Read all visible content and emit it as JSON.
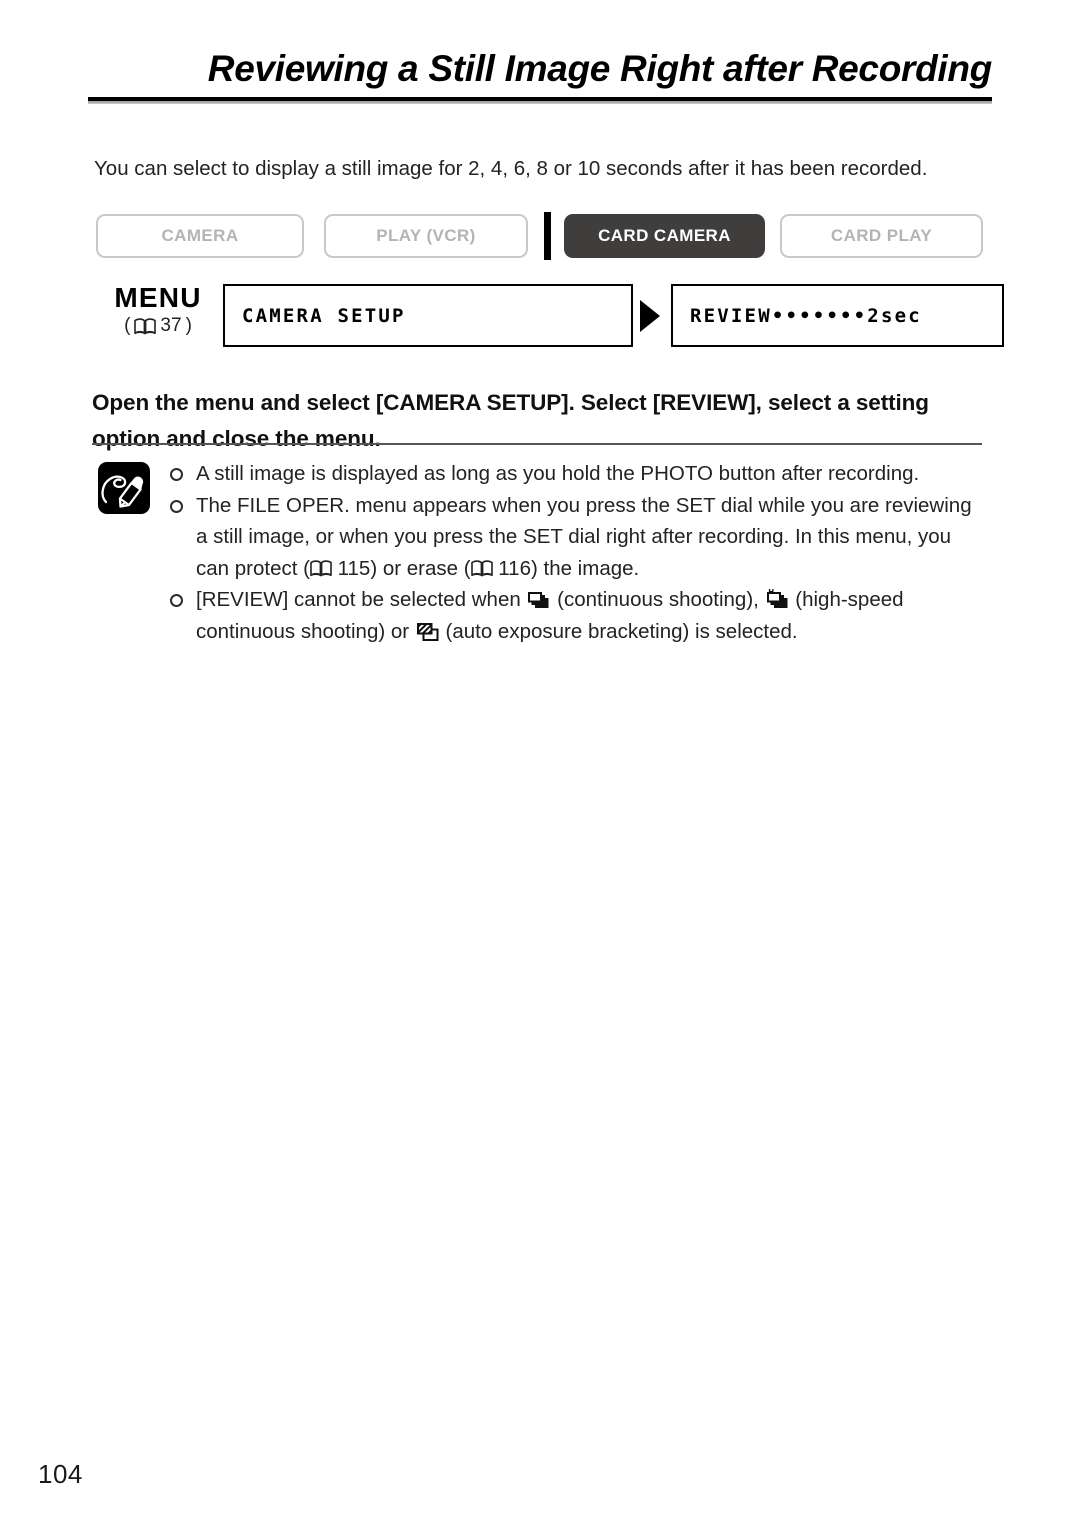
{
  "document": {
    "title": "Reviewing a Still Image Right after Recording",
    "intro": "You can select to display a still image for 2, 4, 6, 8 or 10 seconds after it has been recorded.",
    "page_number": "104"
  },
  "modes": {
    "items": [
      {
        "label": "CAMERA",
        "active": false
      },
      {
        "label": "PLAY (VCR)",
        "active": false
      },
      {
        "label": "CARD CAMERA",
        "active": true
      },
      {
        "label": "CARD PLAY",
        "active": false
      }
    ]
  },
  "menu": {
    "label": "MENU",
    "reference_icon": "book-icon",
    "reference_page": "37",
    "boxes": [
      {
        "text": "CAMERA SETUP"
      },
      {
        "text": "REVIEW•••••••2sec"
      }
    ],
    "arrow_icon": "triangle-right-icon"
  },
  "instruction": "Open the menu and select [CAMERA SETUP]. Select [REVIEW], select a setting option and close the menu.",
  "notes": {
    "icon": "memo-pencil-icon",
    "items": [
      {
        "parts": [
          {
            "type": "text",
            "value": "A still image is displayed as long as you hold the PHOTO button after recording."
          }
        ]
      },
      {
        "parts": [
          {
            "type": "text",
            "value": "The FILE OPER. menu appears when you press the SET dial while you are reviewing a still image, or when you press the SET dial right after recording. In this menu, you can protect ("
          },
          {
            "type": "icon",
            "value": "book-icon"
          },
          {
            "type": "text",
            "value": " 115) or erase ("
          },
          {
            "type": "icon",
            "value": "book-icon"
          },
          {
            "type": "text",
            "value": " 116) the image."
          }
        ]
      },
      {
        "parts": [
          {
            "type": "text",
            "value": "[REVIEW] cannot be selected when "
          },
          {
            "type": "icon",
            "value": "continuous-shooting-icon"
          },
          {
            "type": "text",
            "value": " (continuous shooting), "
          },
          {
            "type": "icon",
            "value": "high-speed-continuous-shooting-icon"
          },
          {
            "type": "text",
            "value": " (high-speed continuous shooting) or "
          },
          {
            "type": "icon",
            "value": "auto-exposure-bracketing-icon"
          },
          {
            "type": "text",
            "value": " (auto exposure bracketing) is selected."
          }
        ]
      }
    ]
  },
  "colors": {
    "active_mode_bg": "#403d3d",
    "inactive_mode_text": "#b4b4b4",
    "rule": "#000000"
  }
}
